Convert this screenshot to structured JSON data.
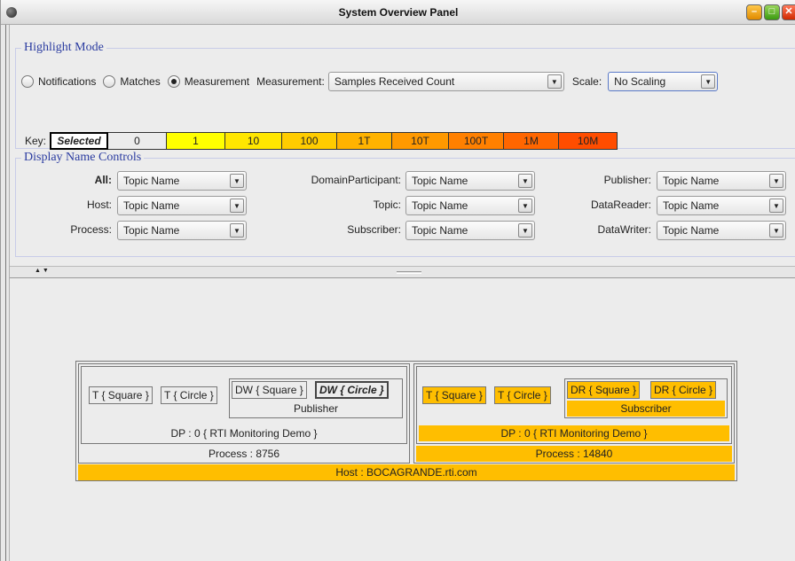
{
  "window": {
    "title": "System Overview Panel"
  },
  "highlight": {
    "title": "Highlight Mode",
    "radios": [
      {
        "label": "Notifications",
        "checked": false
      },
      {
        "label": "Matches",
        "checked": false
      },
      {
        "label": "Measurement",
        "checked": true
      }
    ],
    "measurement_label": "Measurement:",
    "measurement_value": "Samples Received Count",
    "scale_label": "Scale:",
    "scale_value": "No Scaling",
    "key_label": "Key:",
    "key_cells": [
      {
        "label": "Selected",
        "color": "#ffffff"
      },
      {
        "label": "0",
        "color": "#ececec"
      },
      {
        "label": "1",
        "color": "#ffff00"
      },
      {
        "label": "10",
        "color": "#ffe600"
      },
      {
        "label": "100",
        "color": "#ffcc00"
      },
      {
        "label": "1T",
        "color": "#ffb300"
      },
      {
        "label": "10T",
        "color": "#ff9900"
      },
      {
        "label": "100T",
        "color": "#ff8000"
      },
      {
        "label": "1M",
        "color": "#ff6600"
      },
      {
        "label": "10M",
        "color": "#ff4d00"
      }
    ]
  },
  "display_names": {
    "title": "Display Name Controls",
    "controls": [
      {
        "label": "All:",
        "value": "Topic Name"
      },
      {
        "label": "Host:",
        "value": "Topic Name"
      },
      {
        "label": "Process:",
        "value": "Topic Name"
      },
      {
        "label": "DomainParticipant:",
        "value": "Topic Name"
      },
      {
        "label": "Topic:",
        "value": "Topic Name"
      },
      {
        "label": "Subscriber:",
        "value": "Topic Name"
      },
      {
        "label": "Publisher:",
        "value": "Topic Name"
      },
      {
        "label": "DataReader:",
        "value": "Topic Name"
      },
      {
        "label": "DataWriter:",
        "value": "Topic Name"
      }
    ]
  },
  "diagram": {
    "host": "Host : BOCAGRANDE.rti.com",
    "processes": [
      {
        "label": "Process : 8756",
        "dp": "DP : 0 { RTI Monitoring Demo }",
        "topics": [
          "T { Square }",
          "T { Circle }"
        ],
        "group_label": "Publisher",
        "entities": [
          "DW { Square }",
          "DW { Circle }"
        ]
      },
      {
        "label": "Process : 14840",
        "dp": "DP : 0 { RTI Monitoring Demo }",
        "topics": [
          "T { Square }",
          "T { Circle }"
        ],
        "group_label": "Subscriber",
        "entities": [
          "DR { Square }",
          "DR { Circle }"
        ]
      }
    ],
    "highlight_color": "#ffbe00"
  }
}
